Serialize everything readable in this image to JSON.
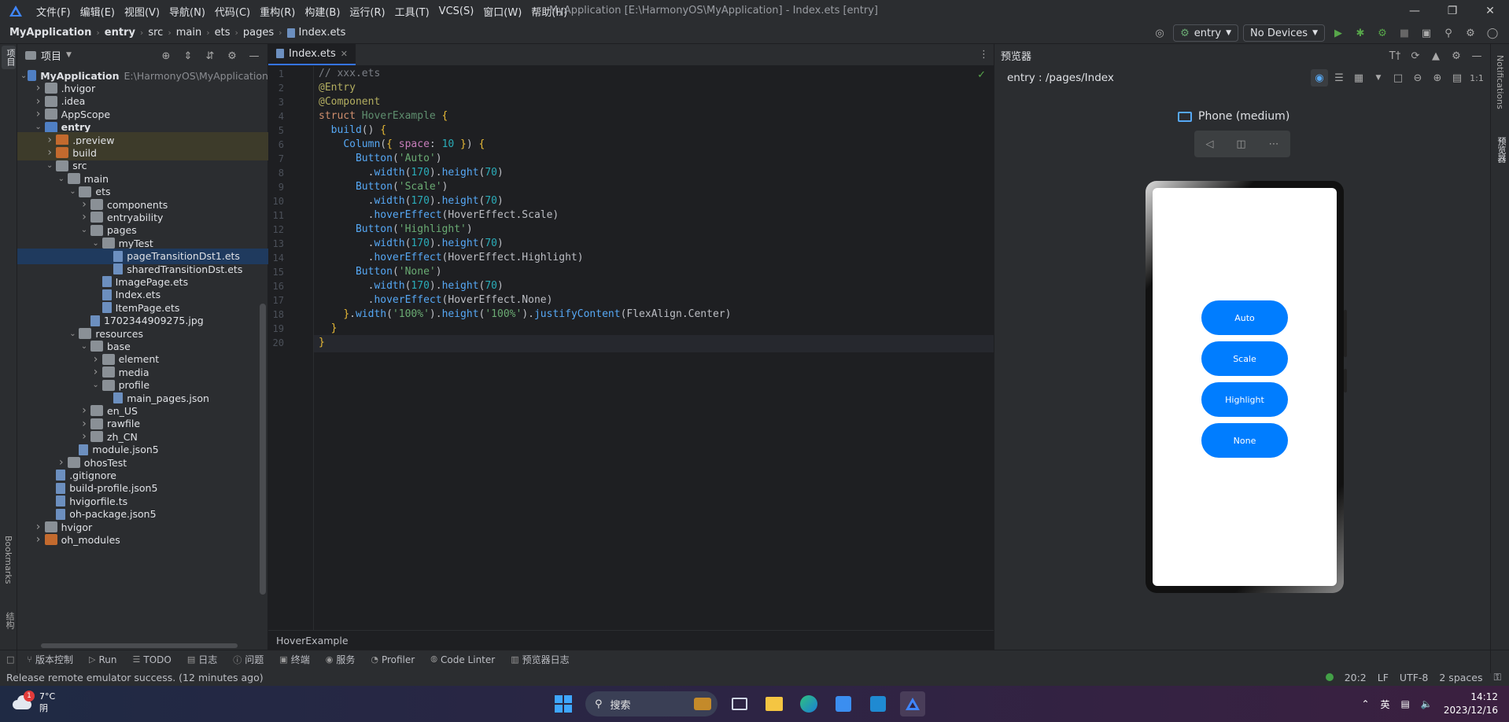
{
  "app": {
    "title": "MyApplication [E:\\HarmonyOS\\MyApplication] - Index.ets [entry]",
    "menus": [
      "文件(F)",
      "编辑(E)",
      "视图(V)",
      "导航(N)",
      "代码(C)",
      "重构(R)",
      "构建(B)",
      "运行(R)",
      "工具(T)",
      "VCS(S)",
      "窗口(W)",
      "帮助(H)"
    ]
  },
  "breadcrumbs": [
    "MyApplication",
    "entry",
    "src",
    "main",
    "ets",
    "pages",
    "Index.ets"
  ],
  "run_config": {
    "module": "entry",
    "device": "No Devices"
  },
  "left_strip": {
    "project": "项目",
    "bookmarks": "Bookmarks",
    "structure": "结构"
  },
  "project_panel": {
    "title": "项目",
    "tree": [
      {
        "label": "MyApplication",
        "hint": "E:\\HarmonyOS\\MyApplication",
        "level": 0,
        "expanded": true,
        "kind": "module"
      },
      {
        "label": ".hvigor",
        "level": 1,
        "expanded": false,
        "kind": "folder"
      },
      {
        "label": ".idea",
        "level": 1,
        "expanded": false,
        "kind": "folder"
      },
      {
        "label": "AppScope",
        "level": 1,
        "expanded": false,
        "kind": "folder"
      },
      {
        "label": "entry",
        "level": 1,
        "expanded": true,
        "kind": "module"
      },
      {
        "label": ".preview",
        "level": 2,
        "expanded": false,
        "kind": "orange"
      },
      {
        "label": "build",
        "level": 2,
        "expanded": false,
        "kind": "orange"
      },
      {
        "label": "src",
        "level": 2,
        "expanded": true,
        "kind": "folder"
      },
      {
        "label": "main",
        "level": 3,
        "expanded": true,
        "kind": "folder"
      },
      {
        "label": "ets",
        "level": 4,
        "expanded": true,
        "kind": "folder"
      },
      {
        "label": "components",
        "level": 5,
        "expanded": false,
        "kind": "folder"
      },
      {
        "label": "entryability",
        "level": 5,
        "expanded": false,
        "kind": "folder"
      },
      {
        "label": "pages",
        "level": 5,
        "expanded": true,
        "kind": "folder"
      },
      {
        "label": "myTest",
        "level": 6,
        "expanded": true,
        "kind": "folder"
      },
      {
        "label": "pageTransitionDst1.ets",
        "level": 7,
        "kind": "file"
      },
      {
        "label": "sharedTransitionDst.ets",
        "level": 7,
        "kind": "file"
      },
      {
        "label": "ImagePage.ets",
        "level": 6,
        "kind": "file"
      },
      {
        "label": "Index.ets",
        "level": 6,
        "kind": "file"
      },
      {
        "label": "ItemPage.ets",
        "level": 6,
        "kind": "file"
      },
      {
        "label": "1702344909275.jpg",
        "level": 5,
        "kind": "file"
      },
      {
        "label": "resources",
        "level": 4,
        "expanded": true,
        "kind": "folder"
      },
      {
        "label": "base",
        "level": 5,
        "expanded": true,
        "kind": "folder"
      },
      {
        "label": "element",
        "level": 6,
        "expanded": false,
        "kind": "folder"
      },
      {
        "label": "media",
        "level": 6,
        "expanded": false,
        "kind": "folder"
      },
      {
        "label": "profile",
        "level": 6,
        "expanded": true,
        "kind": "folder"
      },
      {
        "label": "main_pages.json",
        "level": 7,
        "kind": "file"
      },
      {
        "label": "en_US",
        "level": 5,
        "expanded": false,
        "kind": "folder"
      },
      {
        "label": "rawfile",
        "level": 5,
        "expanded": false,
        "kind": "folder"
      },
      {
        "label": "zh_CN",
        "level": 5,
        "expanded": false,
        "kind": "folder"
      },
      {
        "label": "module.json5",
        "level": 4,
        "kind": "file"
      },
      {
        "label": "ohosTest",
        "level": 3,
        "expanded": false,
        "kind": "folder"
      },
      {
        "label": ".gitignore",
        "level": 2,
        "kind": "file"
      },
      {
        "label": "build-profile.json5",
        "level": 2,
        "kind": "file"
      },
      {
        "label": "hvigorfile.ts",
        "level": 2,
        "kind": "file"
      },
      {
        "label": "oh-package.json5",
        "level": 2,
        "kind": "file"
      },
      {
        "label": "hvigor",
        "level": 1,
        "expanded": false,
        "kind": "folder"
      },
      {
        "label": "oh_modules",
        "level": 1,
        "expanded": false,
        "kind": "orange"
      }
    ]
  },
  "editor": {
    "tab": "Index.ets",
    "current_line": 20,
    "lines": [
      {
        "n": "1",
        "t": "// xxx.ets"
      },
      {
        "n": "2",
        "t": "@Entry"
      },
      {
        "n": "3",
        "t": "@Component"
      },
      {
        "n": "4",
        "t": "struct HoverExample {"
      },
      {
        "n": "5",
        "t": "  build() {"
      },
      {
        "n": "6",
        "t": "    Column({ space: 10 }) {"
      },
      {
        "n": "7",
        "t": "      Button('Auto')"
      },
      {
        "n": "8",
        "t": "        .width(170).height(70)"
      },
      {
        "n": "9",
        "t": "      Button('Scale')"
      },
      {
        "n": "10",
        "t": "        .width(170).height(70)"
      },
      {
        "n": "11",
        "t": "        .hoverEffect(HoverEffect.Scale)"
      },
      {
        "n": "12",
        "t": "      Button('Highlight')"
      },
      {
        "n": "13",
        "t": "        .width(170).height(70)"
      },
      {
        "n": "14",
        "t": "        .hoverEffect(HoverEffect.Highlight)"
      },
      {
        "n": "15",
        "t": "      Button('None')"
      },
      {
        "n": "16",
        "t": "        .width(170).height(70)"
      },
      {
        "n": "17",
        "t": "        .hoverEffect(HoverEffect.None)"
      },
      {
        "n": "18",
        "t": "    }.width('100%').height('100%').justifyContent(FlexAlign.Center)"
      },
      {
        "n": "19",
        "t": "  }"
      },
      {
        "n": "20",
        "t": "}"
      }
    ],
    "breadcrumb": "HoverExample"
  },
  "previewer": {
    "title": "预览器",
    "route": "entry : /pages/Index",
    "device": "Phone (medium)",
    "buttons": [
      "Auto",
      "Scale",
      "Highlight",
      "None"
    ],
    "button_color": "#007dff"
  },
  "right_strip": {
    "notifications": "Notifications",
    "previewer": "预览器"
  },
  "bottom_tools": [
    {
      "label": "版本控制",
      "icon": "vcs-icon"
    },
    {
      "label": "Run",
      "icon": "run-icon"
    },
    {
      "label": "TODO",
      "icon": "todo-icon"
    },
    {
      "label": "日志",
      "icon": "log-icon"
    },
    {
      "label": "问题",
      "icon": "problems-icon"
    },
    {
      "label": "终端",
      "icon": "terminal-icon"
    },
    {
      "label": "服务",
      "icon": "services-icon"
    },
    {
      "label": "Profiler",
      "icon": "profiler-icon"
    },
    {
      "label": "Code Linter",
      "icon": "linter-icon"
    },
    {
      "label": "预览器日志",
      "icon": "preview-log-icon"
    }
  ],
  "status": {
    "message": "Release remote emulator success. (12 minutes ago)",
    "position": "20:2",
    "line_sep": "LF",
    "encoding": "UTF-8",
    "indent": "2 spaces"
  },
  "taskbar": {
    "weather_temp": "7°C",
    "weather_desc": "阴",
    "weather_badge": "1",
    "search": "搜索",
    "ime": "英",
    "time": "14:12",
    "date": "2023/12/16"
  }
}
